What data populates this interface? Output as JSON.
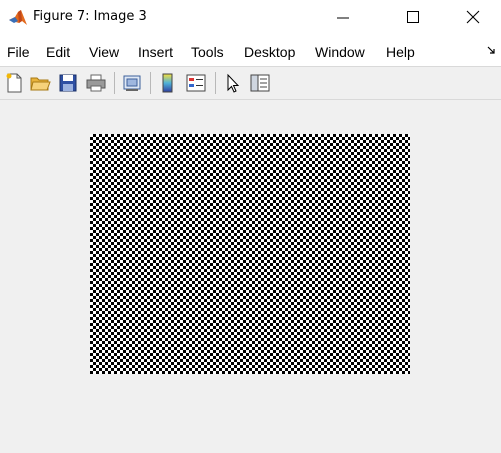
{
  "window": {
    "title": "Figure 7: Image 3",
    "app_icon": "matlab-logo-icon",
    "controls": [
      "minimize-icon",
      "maximize-icon",
      "close-icon"
    ]
  },
  "menubar": {
    "items": [
      "File",
      "Edit",
      "View",
      "Insert",
      "Tools",
      "Desktop",
      "Window",
      "Help"
    ],
    "dock_icon": "dock-arrow-icon"
  },
  "toolbar": {
    "buttons": [
      "new-figure-icon",
      "open-file-icon",
      "save-icon",
      "print-icon",
      "link-plot-icon",
      "insert-colorbar-icon",
      "insert-legend-icon",
      "edit-plot-icon",
      "property-inspector-icon"
    ]
  },
  "figure": {
    "content": "checkerboard image",
    "colors": {
      "dark": "#000000",
      "light": "#ffffff",
      "background": "#f0f0f0"
    }
  }
}
